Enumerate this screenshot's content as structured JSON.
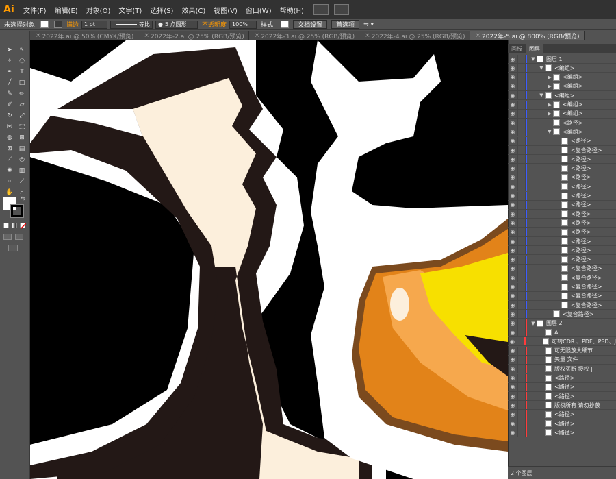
{
  "app": {
    "logo": "Ai"
  },
  "menu": [
    "文件(F)",
    "编辑(E)",
    "对象(O)",
    "文字(T)",
    "选择(S)",
    "效果(C)",
    "视图(V)",
    "窗口(W)",
    "帮助(H)"
  ],
  "controlbar": {
    "selection_label": "未选择对象",
    "stroke_label": "描边",
    "stroke_value": "1 pt",
    "profile_label": "等比",
    "brush_label": "5 点圆形",
    "opacity_label": "不透明度",
    "opacity_value": "100%",
    "style_label": "样式:",
    "doc_setup_button": "文档设置",
    "prefs_button": "首选项"
  },
  "tabs": [
    {
      "label": "2022年.ai @ 50% (CMYK/预览)",
      "active": false
    },
    {
      "label": "2022年-2.ai @ 25% (RGB/预览)",
      "active": false
    },
    {
      "label": "2022年-3.ai @ 25% (RGB/预览)",
      "active": false
    },
    {
      "label": "2022年-4.ai @ 25% (RGB/预览)",
      "active": false
    },
    {
      "label": "2022年-5.ai @ 800% (RGB/预览)",
      "active": true
    }
  ],
  "panel": {
    "tabs": [
      "画板",
      "图层"
    ],
    "active_tab": "图层",
    "footer": "2 个图层",
    "layer1_color": "#3c5cff",
    "layer2_color": "#ff3b3b",
    "rows": [
      {
        "label": "图层 1",
        "indent": 0,
        "twist": "▼",
        "layer": 1
      },
      {
        "label": "<编组>",
        "indent": 1,
        "twist": "▼",
        "layer": 1
      },
      {
        "label": "<编组>",
        "indent": 2,
        "twist": "▶",
        "layer": 1
      },
      {
        "label": "<编组>",
        "indent": 2,
        "twist": "▶",
        "layer": 1
      },
      {
        "label": "<编组>",
        "indent": 1,
        "twist": "▼",
        "layer": 1
      },
      {
        "label": "<编组>",
        "indent": 2,
        "twist": "▶",
        "layer": 1
      },
      {
        "label": "<编组>",
        "indent": 2,
        "twist": "▶",
        "layer": 1
      },
      {
        "label": "<路径>",
        "indent": 2,
        "twist": "",
        "layer": 1
      },
      {
        "label": "<编组>",
        "indent": 2,
        "twist": "▼",
        "layer": 1
      },
      {
        "label": "<路径>",
        "indent": 3,
        "twist": "",
        "layer": 1
      },
      {
        "label": "<复合路径>",
        "indent": 3,
        "twist": "",
        "layer": 1
      },
      {
        "label": "<路径>",
        "indent": 3,
        "twist": "",
        "layer": 1
      },
      {
        "label": "<路径>",
        "indent": 3,
        "twist": "",
        "layer": 1
      },
      {
        "label": "<路径>",
        "indent": 3,
        "twist": "",
        "layer": 1
      },
      {
        "label": "<路径>",
        "indent": 3,
        "twist": "",
        "layer": 1
      },
      {
        "label": "<路径>",
        "indent": 3,
        "twist": "",
        "layer": 1
      },
      {
        "label": "<路径>",
        "indent": 3,
        "twist": "",
        "layer": 1
      },
      {
        "label": "<路径>",
        "indent": 3,
        "twist": "",
        "layer": 1
      },
      {
        "label": "<路径>",
        "indent": 3,
        "twist": "",
        "layer": 1
      },
      {
        "label": "<路径>",
        "indent": 3,
        "twist": "",
        "layer": 1
      },
      {
        "label": "<路径>",
        "indent": 3,
        "twist": "",
        "layer": 1
      },
      {
        "label": "<路径>",
        "indent": 3,
        "twist": "",
        "layer": 1
      },
      {
        "label": "<路径>",
        "indent": 3,
        "twist": "",
        "layer": 1
      },
      {
        "label": "<复合路径>",
        "indent": 3,
        "twist": "",
        "layer": 1
      },
      {
        "label": "<复合路径>",
        "indent": 3,
        "twist": "",
        "layer": 1
      },
      {
        "label": "<复合路径>",
        "indent": 3,
        "twist": "",
        "layer": 1
      },
      {
        "label": "<复合路径>",
        "indent": 3,
        "twist": "",
        "layer": 1
      },
      {
        "label": "<复合路径>",
        "indent": 3,
        "twist": "",
        "layer": 1
      },
      {
        "label": "<复合路径>",
        "indent": 2,
        "twist": "",
        "layer": 1
      },
      {
        "label": "图层 2",
        "indent": 0,
        "twist": "▼",
        "layer": 2
      },
      {
        "label": "Ai",
        "indent": 1,
        "twist": "",
        "layer": 2
      },
      {
        "label": "可转CDR 、PDF、PSD、J",
        "indent": 1,
        "twist": "",
        "layer": 2
      },
      {
        "label": "可无限放大细节",
        "indent": 1,
        "twist": "",
        "layer": 2
      },
      {
        "label": "矢量    文件",
        "indent": 1,
        "twist": "",
        "layer": 2
      },
      {
        "label": "版权买断      授权 |",
        "indent": 1,
        "twist": "",
        "layer": 2
      },
      {
        "label": "<路径>",
        "indent": 1,
        "twist": "",
        "layer": 2
      },
      {
        "label": "<路径>",
        "indent": 1,
        "twist": "",
        "layer": 2
      },
      {
        "label": "<路径>",
        "indent": 1,
        "twist": "",
        "layer": 2
      },
      {
        "label": "版权所有     请勿抄袭",
        "indent": 1,
        "twist": "",
        "layer": 2
      },
      {
        "label": "<路径>",
        "indent": 1,
        "twist": "",
        "layer": 2
      },
      {
        "label": "<路径>",
        "indent": 1,
        "twist": "",
        "layer": 2
      },
      {
        "label": "<路径>",
        "indent": 1,
        "twist": "",
        "layer": 2
      }
    ]
  }
}
